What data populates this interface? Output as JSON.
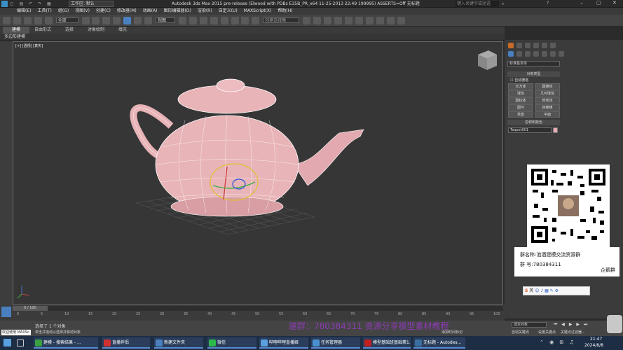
{
  "title": {
    "workspace_label": "工作区: 默认",
    "window_title": "Autodesk 3ds Max  2015 pre-release (Elwood with PDBs E35B_PR_x64 11-25-2013 22:49 199995) ASSERTS=Off   无标题",
    "search_placeholder": "键入关键字或短语"
  },
  "menu": [
    "编辑(E)",
    "工具(T)",
    "组(G)",
    "视图(V)",
    "创建(C)",
    "修改器(M)",
    "动画(A)",
    "图形编辑器(D)",
    "渲染(R)",
    "自定义(U)",
    "MAXScript(X)",
    "帮助(H)"
  ],
  "toolbar": {
    "selection_filter": "全部",
    "ref_coord": "视图",
    "named_sel": "创建选择集"
  },
  "ribbon": {
    "tabs": [
      "建模",
      "自由形式",
      "选择",
      "对象绘制",
      "填充"
    ],
    "sub_label": "多边形建模"
  },
  "viewport": {
    "label": "[+] [透视] [真实]"
  },
  "command_panel": {
    "dropdown": "标准基本体",
    "object_type_header": "对象类型",
    "autogrid": "自动栅格",
    "buttons": [
      "长方体",
      "圆锥体",
      "球体",
      "几何球体",
      "圆柱体",
      "管状体",
      "圆环",
      "四棱锥",
      "茶壶",
      "平面"
    ],
    "name_color_header": "名称和颜色",
    "object_name": "Teapot001",
    "object_color": "#e8a8b0"
  },
  "qr_card": {
    "group_name": "群名称:池酒建模交流资源群",
    "group_number": "群  号:780384311",
    "badge": "企鹅群"
  },
  "ime": {
    "label": "英"
  },
  "timeline": {
    "frame": "0 / 100",
    "ticks": [
      "0",
      "5",
      "10",
      "15",
      "20",
      "25",
      "30",
      "35",
      "40",
      "45",
      "50",
      "55",
      "60",
      "65",
      "70",
      "75",
      "80",
      "85",
      "90",
      "95",
      "100"
    ]
  },
  "status": {
    "welcome": "欢迎使用 MAXSc",
    "line1": "选择了 1 个对象",
    "line2": "单击并拖动以选择并移动对象",
    "add_tag": "添加时间标记",
    "watermark": "建群：780384311 资源分享模型素材教程",
    "anim_mode": "选定对象",
    "auto_key": "自动关键点",
    "set_key": "设置关键点",
    "key_filter": "关键点过滤器..."
  },
  "taskbar": {
    "items": [
      "建模 - 搜索结果 - ...",
      "直播伴侣",
      "新建文件夹",
      "微信",
      "哔哩哔哩直播姬",
      "任务管理器",
      "模型基础班基础第1...",
      "无标题 - Autodes..."
    ],
    "time": "21:47",
    "date": "2024/8/8"
  },
  "colors": {
    "teapot": "#e8b4b8",
    "accent": "#5a8ad0"
  }
}
